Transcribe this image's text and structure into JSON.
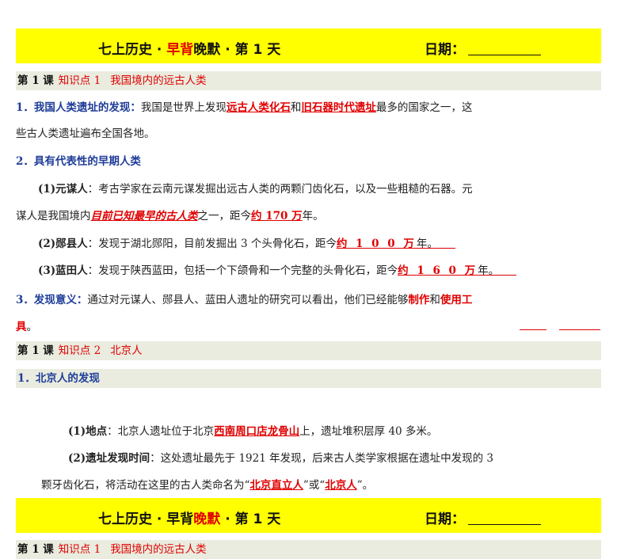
{
  "header": {
    "title_prefix": "七上历史 · ",
    "title_morning": "早背",
    "title_evening": "晚默",
    "title_suffix": " · 第 1 天",
    "date_label": "日期："
  },
  "section1": {
    "lesson": "第 1 课",
    "kp": "知识点 1",
    "kp_title": "我国境内的远古人类"
  },
  "p1": {
    "heading": "1．我国人类遗址的发现：",
    "text_a": "我国是世界上发现",
    "ans1": "远古人类化石",
    "text_b": "和",
    "ans2": "旧石器时代遗址",
    "text_c": "最多的国家之一，这",
    "line2": "些古人类遗址遍布全国各地。"
  },
  "p2": {
    "heading": "2．具有代表性的早期人类"
  },
  "p2a": {
    "label": "(1)元谋人",
    "text_a": "：考古学家在云南元谋发掘出远古人类的两颗门齿化石，以及一些粗糙的石器。元",
    "text_b": "谋人是我国境内",
    "ans1": "目前已知最早的古人类",
    "text_c": "之一，距今",
    "ans2": "约 170 万",
    "text_d": "年。"
  },
  "p2b": {
    "label": "(2)郧县人",
    "text_a": "：发现于湖北郧阳，目前发掘出 3 个头骨化石，距今",
    "ans1": "约 1 0 0 万",
    "text_b": "年。"
  },
  "p2c": {
    "label": "(3)蓝田人",
    "text_a": "：发现于陕西蓝田，包括一个下颌骨和一个完整的头骨化石，距今",
    "ans1": "约 1 6 0 万",
    "text_b": "年。"
  },
  "p3": {
    "heading": "3．发现意义：",
    "text_a": "通过对元谋人、郧县人、蓝田人遗址的研究可以看出，他们已经能够",
    "ans1": "制作",
    "text_b": "和",
    "ans2": "使用工",
    "line2_ans": "具",
    "line2_end": "。"
  },
  "section2": {
    "lesson": "第 1 课",
    "kp": "知识点 2",
    "kp_title": "北京人"
  },
  "p4": {
    "heading": "1．北京人的发现"
  },
  "p4a": {
    "label": "(1)地点",
    "text_a": "：北京人遗址位于北京",
    "ans1": "西南周口店龙骨山",
    "text_b": "上，遗址堆积层厚 40 多米。"
  },
  "p4b": {
    "label": "(2)遗址发现时间",
    "text_a": "：这处遗址最先于 1921 年发现，后来古人类学家根据在遗址中发现的 3",
    "text_b": "颗牙齿化石，将活动在这里的古人类命名为“",
    "ans1": "北京直立人",
    "text_c": "”或“",
    "ans2": "北京人",
    "text_d": "”。"
  }
}
